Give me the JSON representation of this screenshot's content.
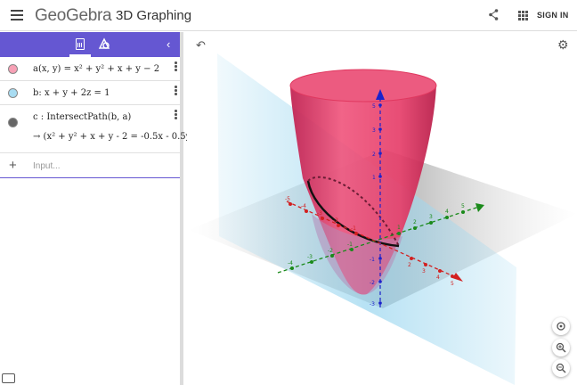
{
  "header": {
    "logo": "GeoGebra",
    "app_title": "3D Graphing",
    "signin_label": "SIGN IN"
  },
  "algebra": {
    "rows": [
      {
        "color": "#f7a0b5",
        "expr": "a(x, y) = x² + y² + x + y − 2"
      },
      {
        "color": "#a8dcf2",
        "expr": "b: x + y + 2z = 1"
      },
      {
        "color": "#666666",
        "expr": "c : IntersectPath(b, a)",
        "result": "→  (x² + y² + x + y - 2 = -0.5x - 0.5y -"
      }
    ],
    "input_placeholder": "Input..."
  },
  "graphics": {
    "colors": {
      "surface": "#e6406b",
      "plane": "#9fd8f0",
      "x_axis": "#d22020",
      "y_axis": "#1a8a1a",
      "z_axis": "#1a22cc"
    },
    "tick_labels": {
      "z": [
        "5",
        "3",
        "2",
        "1",
        "-1",
        "-2",
        "-3"
      ],
      "y": [
        "5",
        "4",
        "3",
        "2",
        "1",
        "-1",
        "-2",
        "-3",
        "-4"
      ],
      "x": [
        "2",
        "3",
        "4",
        "5",
        "-1",
        "-2",
        "-3",
        "-4",
        "-5"
      ]
    }
  }
}
